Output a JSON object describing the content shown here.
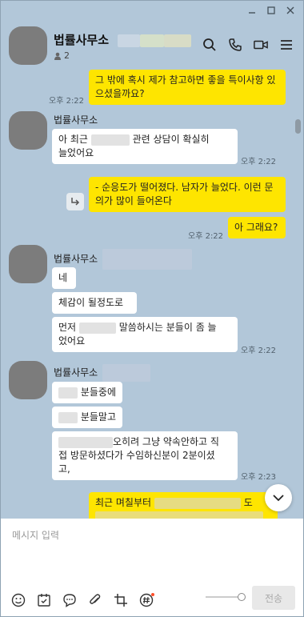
{
  "window": {
    "controls": [
      "minimize",
      "maximize",
      "close"
    ]
  },
  "header": {
    "title": "법률사무소",
    "member_count": "2",
    "icons": [
      "search-icon",
      "phone-icon",
      "video-icon",
      "menu-icon"
    ]
  },
  "messages": {
    "m1": {
      "text": "그 밖에 혹시 제가 참고하면 좋을 특이사항 있으셨을까요?",
      "time": "오후 2:22"
    },
    "g1": {
      "sender": "법률사무소",
      "l1a": "아 최근",
      "l1b": "관련 상담이 확실히",
      "l2": "늘었어요",
      "time": "오후 2:22"
    },
    "m2": {
      "text": "- 순응도가 떨어졌다. 남자가 늘었다. 이런 문의가 많이 들어온다"
    },
    "m3": {
      "text": "아 그래요?",
      "time": "오후 2:22"
    },
    "g2": {
      "sender": "법률사무소",
      "b1": "네",
      "b2": "체감이 될정도로",
      "b3a": "먼저",
      "b3b": "말씀하시는 분들이 좀 늘",
      "b3c": "었어요",
      "time": "오후 2:22"
    },
    "g3": {
      "sender": "법률사무소",
      "b1": "분들중에",
      "b2": "분들말고",
      "b3a": "오히려 그냥 약속안하고 직",
      "b3b": "접 방문하셨다가 수임하신분이 2분이셨",
      "b3c": "고,",
      "time": "오후 2:23"
    },
    "m4": {
      "a": "최근 며칠부터",
      "b": "도"
    }
  },
  "input": {
    "placeholder": "메시지 입력",
    "send_label": "전송"
  },
  "toolbar": [
    "emoji-icon",
    "calendar-icon",
    "chat-bubble-icon",
    "attach-icon",
    "crop-icon",
    "hashtag-icon"
  ],
  "colors": {
    "bg": "#b2c7d9",
    "mine": "#fee500",
    "theirs": "#ffffff",
    "accent_dot": "#ff4e2a"
  }
}
